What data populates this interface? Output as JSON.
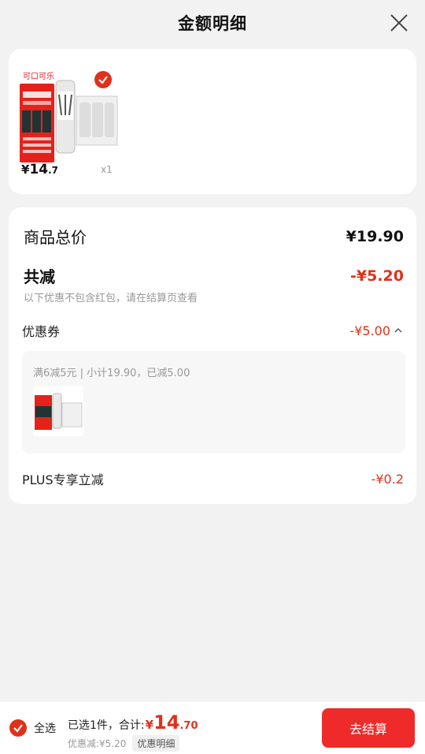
{
  "header": {
    "title": "金额明细"
  },
  "product": {
    "brand_logo_text": "可口可乐",
    "price_symbol": "¥",
    "price_int": "14",
    "price_dec": ".7",
    "qty": "x1"
  },
  "summary": {
    "total_label": "商品总价",
    "total_value": "¥19.90",
    "reduce_label": "共减",
    "reduce_value": "-¥5.20",
    "reduce_note": "以下优惠不包含红包，请在结算页查看",
    "coupon_label": "优惠券",
    "coupon_value": "-¥5.00",
    "coupon_detail": "满6减5元 | 小计19.90，已减5.00",
    "plus_label": "PLUS专享立减",
    "plus_value": "-¥0.2"
  },
  "bottom": {
    "select_all": "全选",
    "selected_text": "已选1件，合计:",
    "total_symbol": "¥",
    "total_int": "14",
    "total_dec": ".70",
    "discount_text": "优惠减:¥5.20",
    "detail_tag": "优惠明细",
    "checkout": "去结算"
  },
  "colors": {
    "accent": "#e0311b",
    "button": "#ef2a2a"
  },
  "icons": [
    "close-icon",
    "check-circle-icon",
    "chevron-up-icon"
  ]
}
